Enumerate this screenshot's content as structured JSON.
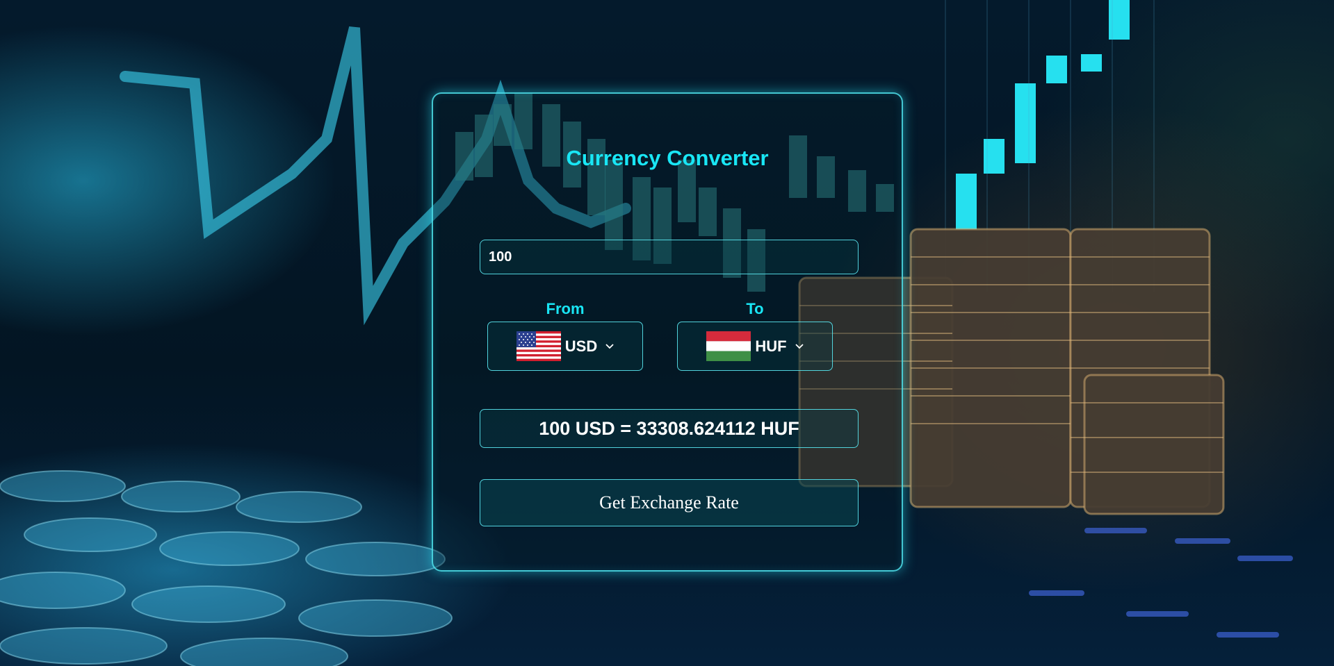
{
  "app": {
    "title": "Currency Converter"
  },
  "amount_input": {
    "value": "100"
  },
  "from": {
    "label": "From",
    "currency": "USD",
    "flag_icon": "us-flag-icon"
  },
  "to": {
    "label": "To",
    "currency": "HUF",
    "flag_icon": "hungary-flag-icon"
  },
  "result": {
    "text": "100 USD = 33308.624112 HUF"
  },
  "button": {
    "label": "Get Exchange Rate"
  },
  "colors": {
    "accent": "#19e6f5",
    "border": "#5ae6f0",
    "text": "#ffffff"
  }
}
